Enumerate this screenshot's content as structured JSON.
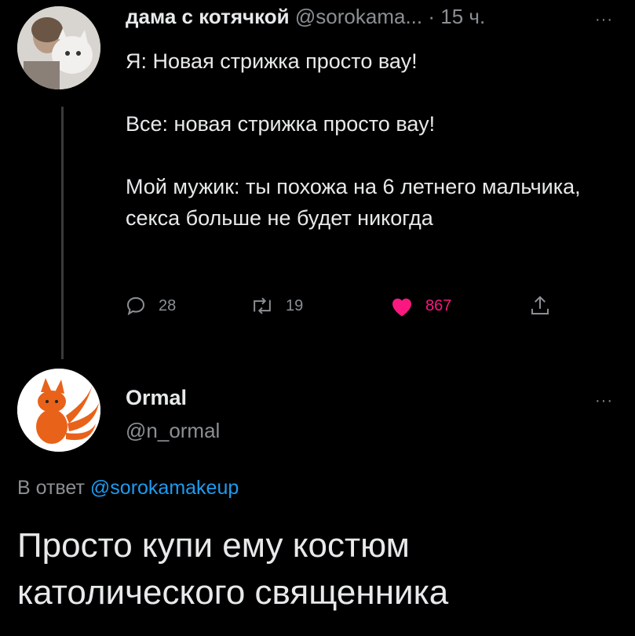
{
  "tweet1": {
    "name": "дама с котячкой",
    "handle": "@sorokama...",
    "separator": " · ",
    "time": "15 ч.",
    "more": "···",
    "lines": [
      "Я: Новая стрижка просто вау!",
      "Все: новая стрижка просто вау!",
      "Мой мужик: ты похожа на 6 летнего мальчика, секса больше не будет никогда"
    ],
    "counts": {
      "replies": "28",
      "retweets": "19",
      "likes": "867"
    }
  },
  "tweet2": {
    "name": "Ormal",
    "handle": "@n_ormal",
    "more": "···",
    "reply_prefix": "В ответ ",
    "reply_handle": "@sorokamakeup",
    "text": "Просто купи ему костюм католического священника"
  },
  "colors": {
    "like": "#f91880",
    "link": "#1d9bf0",
    "muted": "#8b8f93"
  }
}
